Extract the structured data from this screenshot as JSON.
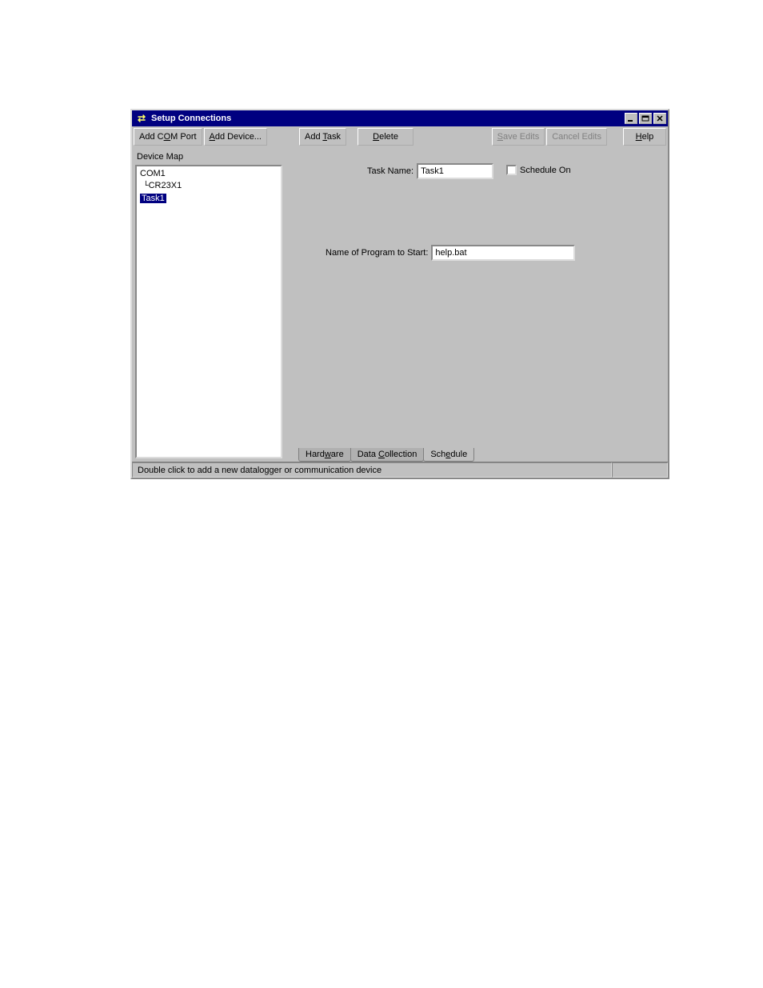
{
  "window": {
    "title": "Setup Connections"
  },
  "toolbar": {
    "add_com_port": "Add COM Port",
    "add_device": "Add Device...",
    "add_task": "Add Task",
    "delete": "Delete",
    "save_edits": "Save Edits",
    "cancel_edits": "Cancel Edits",
    "help": "Help"
  },
  "left": {
    "label": "Device Map",
    "items": [
      {
        "label": "COM1",
        "level": 0,
        "selected": false
      },
      {
        "label": "CR23X1",
        "level": 1,
        "selected": false
      },
      {
        "label": "Task1",
        "level": 0,
        "selected": true
      }
    ]
  },
  "form": {
    "task_name_label": "Task Name:",
    "task_name_value": "Task1",
    "schedule_on_label": "Schedule On",
    "schedule_on_checked": false,
    "program_start_label": "Name of Program to Start:",
    "program_start_value": "help.bat"
  },
  "tabs": [
    {
      "label": "Hardware",
      "hotkey_index": 4,
      "active": false
    },
    {
      "label": "Data Collection",
      "hotkey_index": 5,
      "active": false
    },
    {
      "label": "Schedule",
      "hotkey_index": 3,
      "active": true
    }
  ],
  "statusbar": {
    "message": "Double click to add a new datalogger or communication device"
  }
}
